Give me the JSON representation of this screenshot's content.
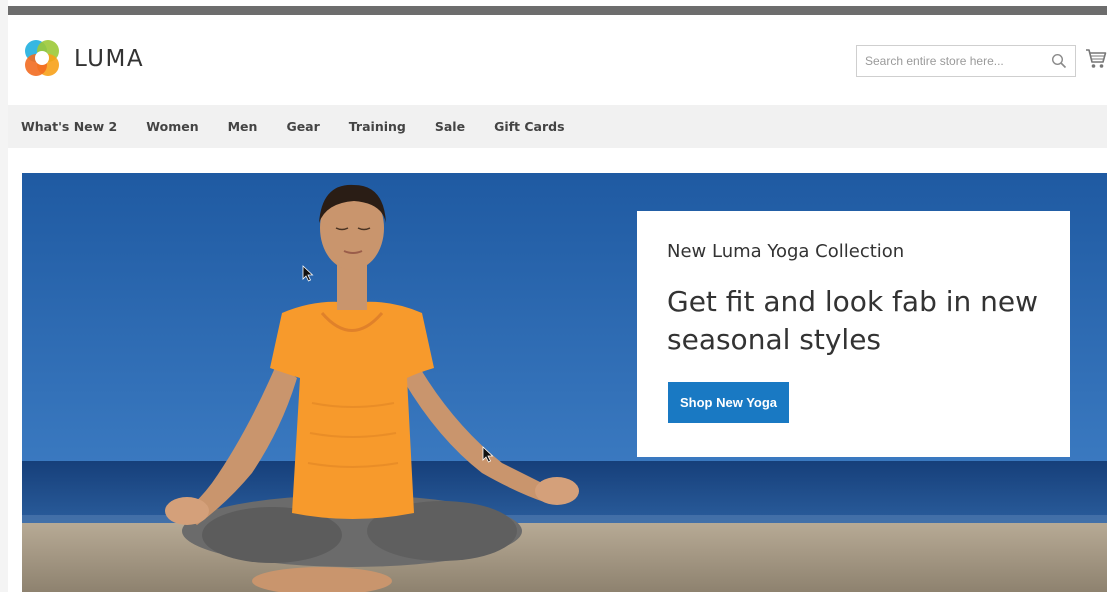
{
  "brand": {
    "name": "LUMA"
  },
  "search": {
    "placeholder": "Search entire store here..."
  },
  "nav": {
    "items": [
      "What's New 2",
      "Women",
      "Men",
      "Gear",
      "Training",
      "Sale",
      "Gift Cards"
    ]
  },
  "hero": {
    "subtitle": "New Luma Yoga Collection",
    "headline": "Get fit and look fab in new seasonal styles",
    "cta_label": "Shop New Yoga"
  },
  "colors": {
    "accent": "#1979c3",
    "nav_bg": "#f1f1f1",
    "sky": "#2a63a8",
    "shirt": "#f79a2c"
  },
  "icons": [
    "luma-logo-icon",
    "search-icon",
    "cart-icon",
    "mouse-cursor-icon"
  ]
}
